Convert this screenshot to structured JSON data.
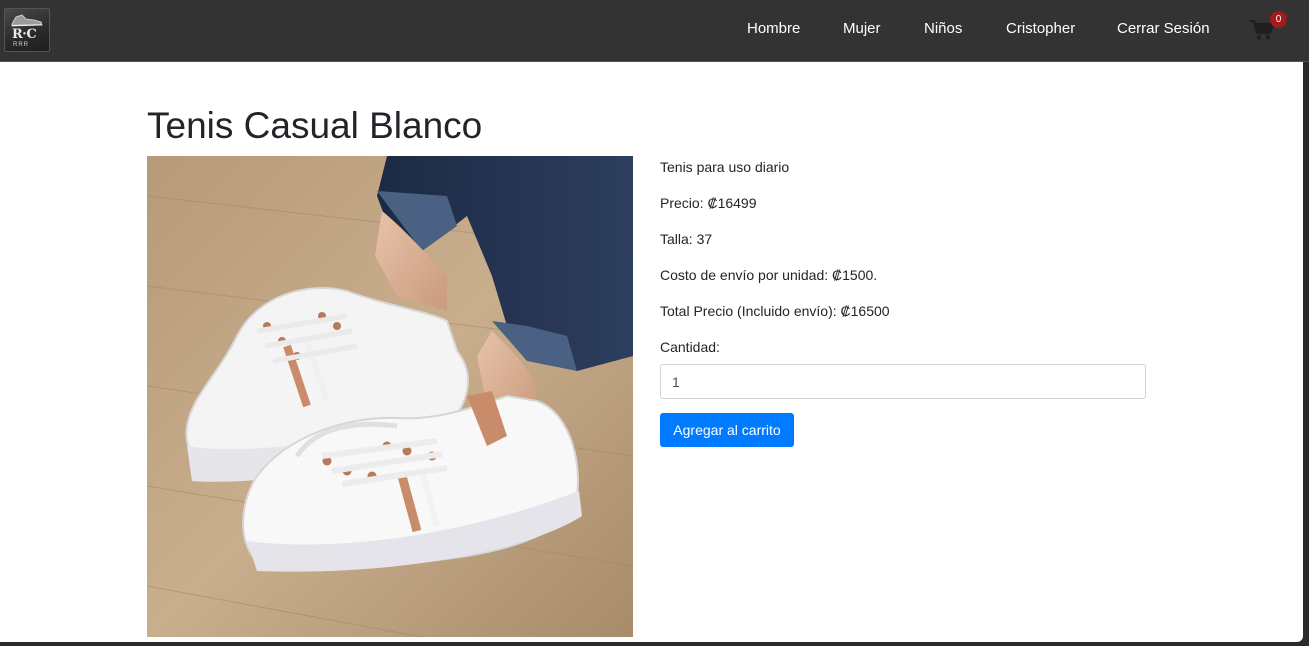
{
  "header": {
    "logo": {
      "text": "R·C",
      "sub": "RRR"
    },
    "nav": [
      {
        "label": "Hombre"
      },
      {
        "label": "Mujer"
      },
      {
        "label": "Niños"
      },
      {
        "label": "Cristopher"
      },
      {
        "label": "Cerrar Sesión"
      }
    ],
    "cart": {
      "count": "0",
      "icon": "cart-icon"
    }
  },
  "product": {
    "title": "Tenis Casual Blanco",
    "description": "Tenis para uso diario",
    "price": "Precio: ₡16499",
    "size": "Talla: 37",
    "shipping": "Costo de envío por unidad: ₡1500.",
    "total": "Total Precio (Incluido envío): ₡16500",
    "quantity_label": "Cantidad:",
    "quantity_value": "1",
    "add_button": "Agregar al carrito"
  },
  "colors": {
    "navbar": "#333333",
    "primary": "#007bff",
    "badge": "#a31b1b"
  }
}
